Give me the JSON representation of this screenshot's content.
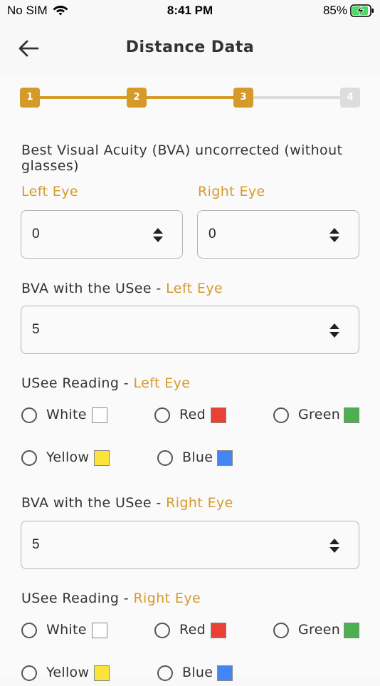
{
  "status": {
    "carrier": "No SIM",
    "time": "8:41 PM",
    "battery": "85%"
  },
  "header": {
    "title": "Distance Data"
  },
  "steps": [
    "1",
    "2",
    "3",
    "4"
  ],
  "current_step": 3,
  "colors": {
    "accent": "#d59a2a",
    "inactive": "#dddddd",
    "white": "#ffffff",
    "red": "#e94235",
    "green": "#4caf50",
    "yellow": "#fbe33b",
    "blue": "#4285f4"
  },
  "bva_uncorrected": {
    "label_line1": "Best Visual Acuity (BVA) uncorrected (without",
    "label_line2": "glasses)",
    "left_label": "Left Eye",
    "right_label": "Right Eye",
    "left_value": "0",
    "right_value": "0"
  },
  "bva_usee_left": {
    "prefix": "BVA with the USee - ",
    "eye": "Left Eye",
    "value": "5"
  },
  "reading_left": {
    "prefix": "USee Reading - ",
    "eye": "Left Eye",
    "options": [
      "White",
      "Red",
      "Green",
      "Yellow",
      "Blue"
    ]
  },
  "bva_usee_right": {
    "prefix": "BVA with the USee - ",
    "eye": "Right Eye",
    "value": "5"
  },
  "reading_right": {
    "prefix": "USee Reading - ",
    "eye": "Right Eye",
    "options": [
      "White",
      "Red",
      "Green",
      "Yellow",
      "Blue"
    ]
  }
}
